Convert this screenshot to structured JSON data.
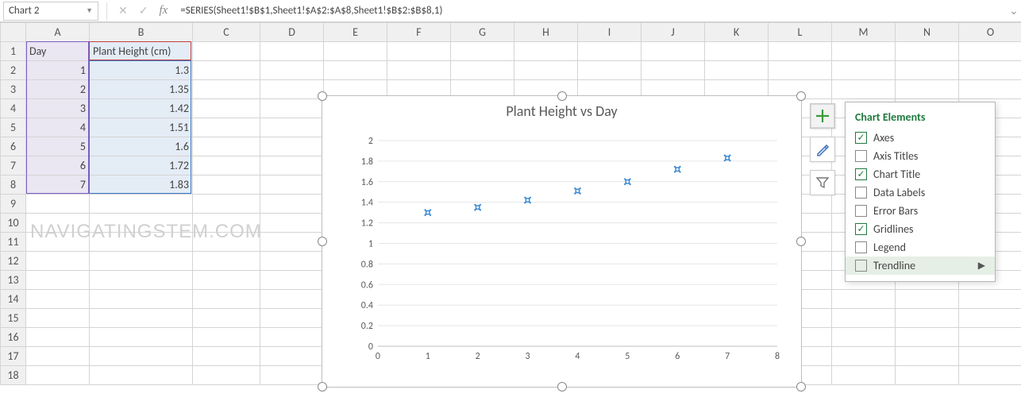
{
  "formula_bar": {
    "name_box": "Chart 2",
    "formula": "=SERIES(Sheet1!$B$1,Sheet1!$A$2:$A$8,Sheet1!$B$2:$B$8,1)"
  },
  "columns": [
    "A",
    "B",
    "C",
    "D",
    "E",
    "F",
    "G",
    "H",
    "I",
    "J",
    "K",
    "L",
    "M",
    "N",
    "O"
  ],
  "row_count": 18,
  "headers": {
    "A": "Day",
    "B": "Plant Height (cm)"
  },
  "table_data": [
    {
      "day": 1,
      "height": 1.3
    },
    {
      "day": 2,
      "height": 1.35
    },
    {
      "day": 3,
      "height": 1.42
    },
    {
      "day": 4,
      "height": 1.51
    },
    {
      "day": 5,
      "height": 1.6
    },
    {
      "day": 6,
      "height": 1.72
    },
    {
      "day": 7,
      "height": 1.83
    }
  ],
  "watermark": "NAVIGATINGSTEM.COM",
  "chart_data": {
    "type": "scatter",
    "title": "Plant Height vs Day",
    "xlabel": "",
    "ylabel": "",
    "xlim": [
      0,
      8
    ],
    "ylim": [
      0,
      2
    ],
    "xticks": [
      0,
      1,
      2,
      3,
      4,
      5,
      6,
      7,
      8
    ],
    "yticks": [
      0,
      0.2,
      0.4,
      0.6,
      0.8,
      1,
      1.2,
      1.4,
      1.6,
      1.8,
      2
    ],
    "x": [
      1,
      2,
      3,
      4,
      5,
      6,
      7
    ],
    "y": [
      1.3,
      1.35,
      1.42,
      1.51,
      1.6,
      1.72,
      1.83
    ],
    "grid": true,
    "legend": false
  },
  "side_buttons": {
    "plus": "chart-elements",
    "brush": "chart-styles",
    "funnel": "chart-filters"
  },
  "popup": {
    "title": "Chart Elements",
    "items": [
      {
        "label": "Axes",
        "checked": true
      },
      {
        "label": "Axis Titles",
        "checked": false
      },
      {
        "label": "Chart Title",
        "checked": true
      },
      {
        "label": "Data Labels",
        "checked": false
      },
      {
        "label": "Error Bars",
        "checked": false
      },
      {
        "label": "Gridlines",
        "checked": true
      },
      {
        "label": "Legend",
        "checked": false
      },
      {
        "label": "Trendline",
        "checked": false,
        "hovered": true,
        "submenu": true
      }
    ]
  }
}
